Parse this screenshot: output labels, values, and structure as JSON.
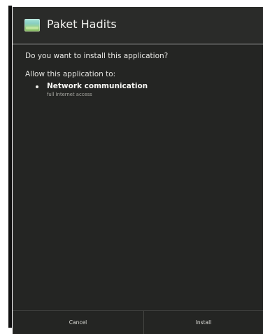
{
  "dialog": {
    "title": "Paket Hadits",
    "question": "Do you want to install this application?",
    "permissions_header": "Allow this application to:",
    "permissions": [
      {
        "title": "Network communication",
        "description": "full Internet access"
      }
    ],
    "buttons": {
      "cancel": "Cancel",
      "install": "Install"
    }
  },
  "icons": {
    "app": "app-icon",
    "permission_bullet": "bullet-icon"
  },
  "colors": {
    "dialog_background": "#242523",
    "title_background": "#2a2b29",
    "text_primary": "#f1f1ee",
    "text_secondary": "#a8a8a2",
    "divider": "#454643"
  }
}
